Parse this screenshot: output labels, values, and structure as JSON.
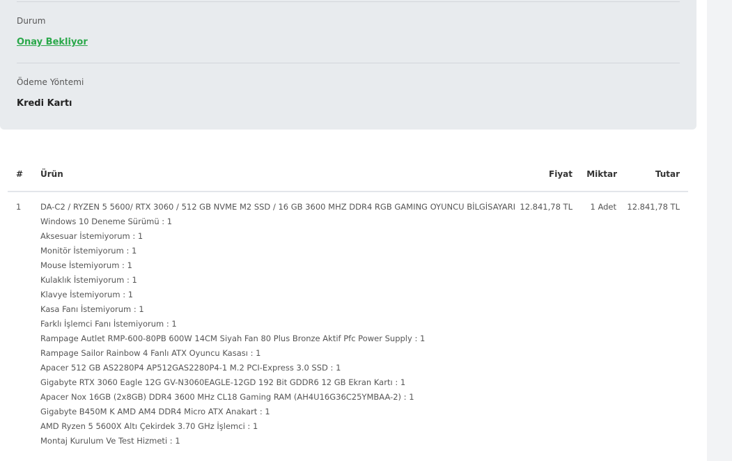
{
  "order_info": {
    "status_label": "Durum",
    "status_value": "Onay Bekliyor",
    "payment_label": "Ödeme Yöntemi",
    "payment_value": "Kredi Kartı"
  },
  "table": {
    "headers": {
      "index": "#",
      "product": "Ürün",
      "price": "Fiyat",
      "quantity": "Miktar",
      "total": "Tutar"
    },
    "rows": [
      {
        "index": "1",
        "product": "DA-C2 / RYZEN 5 5600/ RTX 3060 / 512 GB NVME M2 SSD / 16 GB 3600 MHZ DDR4 RGB GAMING OYUNCU BİLGİSAYARI",
        "price": "12.841,78 TL",
        "quantity": "1 Adet",
        "total": "12.841,78 TL",
        "options": [
          "Windows 10 Deneme Sürümü : 1",
          "Aksesuar İstemiyorum : 1",
          "Monitör İstemiyorum : 1",
          "Mouse İstemiyorum : 1",
          "Kulaklık İstemiyorum : 1",
          "Klavye İstemiyorum : 1",
          "Kasa Fanı İstemiyorum : 1",
          "Farklı İşlemci Fanı İstemiyorum : 1",
          "Rampage Autlet RMP-600-80PB 600W 14CM Siyah Fan 80 Plus Bronze Aktif Pfc Power Supply : 1",
          "Rampage Sailor Rainbow 4 Fanlı ATX Oyuncu Kasası : 1",
          "Apacer 512 GB AS2280P4 AP512GAS2280P4-1 M.2 PCI-Express 3.0 SSD : 1",
          "Gigabyte RTX 3060 Eagle 12G GV-N3060EAGLE-12GD 192 Bit GDDR6 12 GB Ekran Kartı : 1",
          "Apacer Nox 16GB (2x8GB) DDR4 3600 MHz CL18 Gaming RAM (AH4U16G36C25YMBAA-2) : 1",
          "Gigabyte B450M K AMD AM4 DDR4 Micro ATX Anakart : 1",
          "AMD Ryzen 5 5600X Altı Çekirdek 3.70 GHz İşlemci : 1",
          "Montaj Kurulum Ve Test Hizmeti : 1"
        ]
      }
    ]
  }
}
